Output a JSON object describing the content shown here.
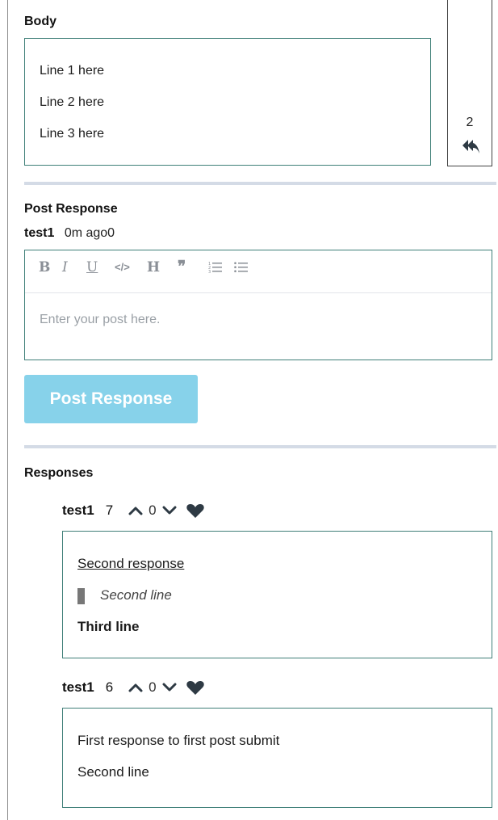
{
  "body_section": {
    "title": "Body",
    "lines": [
      "Line 1 here",
      "Line 2 here",
      "Line 3 here"
    ],
    "reply_count": "2"
  },
  "post_response": {
    "title": "Post Response",
    "user": "test1",
    "time": "0m ago0",
    "toolbar": {
      "bold": "B",
      "italic": "I",
      "underline": "U",
      "code": "</>",
      "heading": "H",
      "quote": "❞",
      "ordered_list_icon": "ordered-list-icon",
      "unordered_list_icon": "unordered-list-icon"
    },
    "placeholder": "Enter your post here.",
    "button_label": "Post Response"
  },
  "responses": {
    "title": "Responses",
    "items": [
      {
        "user": "test1",
        "count": "7",
        "score": "0",
        "lines": [
          "Second response",
          "Second line",
          "Third line"
        ]
      },
      {
        "user": "test1",
        "count": "6",
        "score": "0",
        "lines": [
          "First response to first post submit",
          "Second line"
        ]
      }
    ]
  },
  "colors": {
    "accent_border": "#3f7f78",
    "button_bg": "#87d2ea",
    "divider": "#d4dbe6",
    "icon_dark": "#2e3a44"
  }
}
